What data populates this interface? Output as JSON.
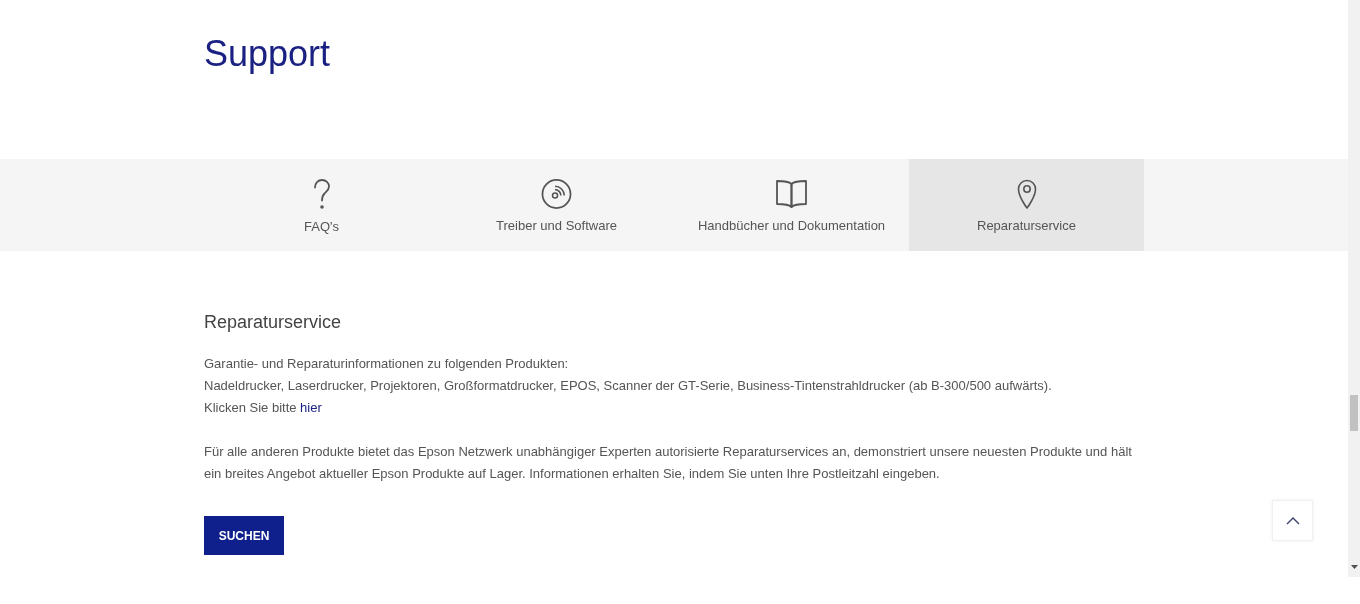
{
  "page": {
    "title": "Support"
  },
  "tabs": [
    {
      "label": "FAQ's",
      "selected": false
    },
    {
      "label": "Treiber und Software",
      "selected": false
    },
    {
      "label": "Handbücher und Dokumentation",
      "selected": false
    },
    {
      "label": "Reparaturservice",
      "selected": true
    }
  ],
  "section": {
    "heading": "Reparaturservice",
    "lines": [
      "Garantie- und Reparaturinformationen zu folgenden Produkten:",
      "Nadeldrucker, Laserdrucker, Projektoren, Großformatdrucker, EPOS, Scanner der GT-Serie, Business-Tintenstrahldrucker (ab B-300/500 aufwärts)."
    ],
    "link_line": {
      "text": "Klicken Sie bitte",
      "link": "hier"
    },
    "paragraph": "Für alle anderen Produkte bietet das Epson Netzwerk unabhängiger Experten autorisierte Reparaturservices an, demonstriert unsere neuesten Produkte und hält ein breites Angebot aktueller Epson Produkte auf Lager. Informationen erhalten Sie, indem Sie unten Ihre Postleitzahl eingeben.",
    "button": "SUCHEN"
  }
}
